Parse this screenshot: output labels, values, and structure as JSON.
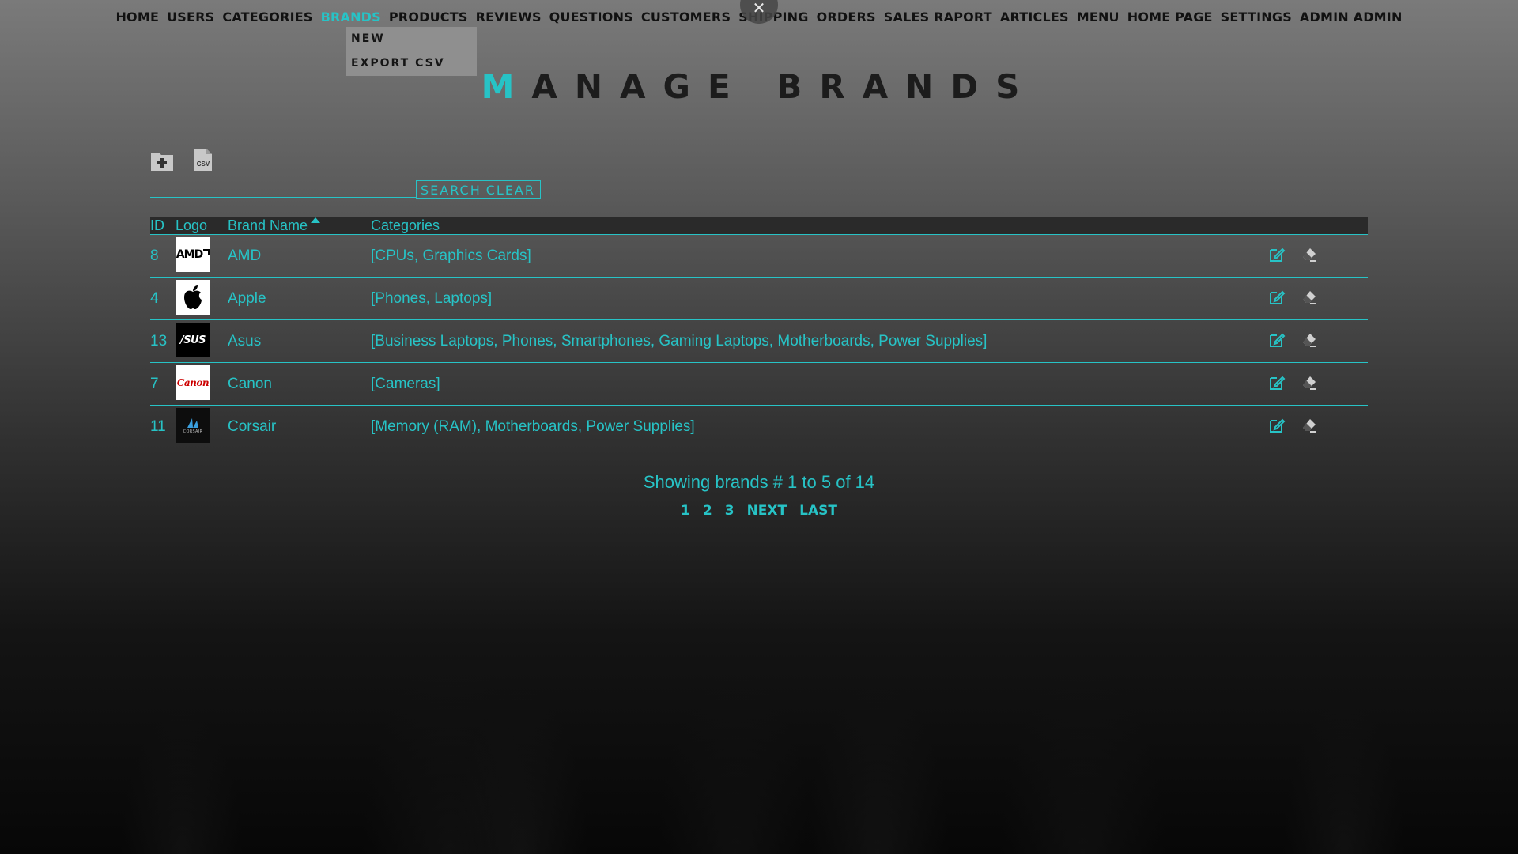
{
  "nav": {
    "items": [
      "HOME",
      "USERS",
      "CATEGORIES",
      "BRANDS",
      "PRODUCTS",
      "REVIEWS",
      "QUESTIONS",
      "CUSTOMERS",
      "SHIPPING",
      "ORDERS",
      "SALES RAPORT",
      "ARTICLES",
      "MENU",
      "HOME PAGE",
      "SETTINGS",
      "ADMIN ADMIN"
    ],
    "active": "BRANDS",
    "close_glyph": "✕"
  },
  "dropdown": {
    "items": [
      "NEW",
      "EXPORT CSV"
    ]
  },
  "title": {
    "first_letter": "M",
    "rest": "ANAGE BRANDS"
  },
  "toolbar": {
    "csv_icon_text": "CSV"
  },
  "search": {
    "value": "",
    "placeholder": "",
    "search_label": "SEARCH",
    "clear_label": "CLEAR"
  },
  "table": {
    "headers": {
      "id": "ID",
      "logo": "Logo",
      "name": "Brand Name",
      "categories": "Categories"
    },
    "sort": {
      "column": "Brand Name",
      "direction": "ascending"
    },
    "rows": [
      {
        "id": "8",
        "name": "AMD",
        "categories": "[CPUs, Graphics Cards]",
        "logo_text": "AMD"
      },
      {
        "id": "4",
        "name": "Apple",
        "categories": "[Phones, Laptops]",
        "logo_text": ""
      },
      {
        "id": "13",
        "name": "Asus",
        "categories": "[Business Laptops, Phones, Smartphones, Gaming Laptops, Motherboards, Power Supplies]",
        "logo_text": "/SUS"
      },
      {
        "id": "7",
        "name": "Canon",
        "categories": "[Cameras]",
        "logo_text": "Canon"
      },
      {
        "id": "11",
        "name": "Corsair",
        "categories": "[Memory (RAM), Motherboards, Power Supplies]",
        "logo_text": "CORSAIR"
      }
    ]
  },
  "summary": "Showing brands # 1 to 5 of 14",
  "pagination": {
    "pages": [
      "1",
      "2",
      "3"
    ],
    "next": "NEXT",
    "last": "LAST"
  },
  "colors": {
    "accent": "#27c3c6",
    "nav_text": "#111111",
    "table_header_bg": "#2a2a2a"
  }
}
